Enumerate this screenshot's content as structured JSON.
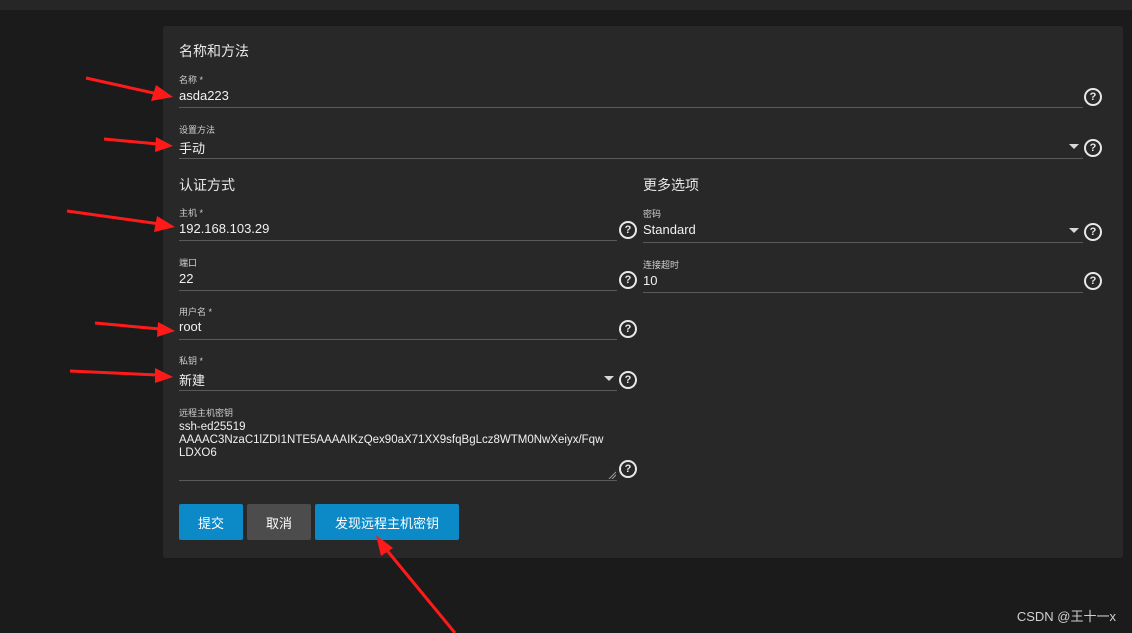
{
  "form": {
    "section_name_method": "名称和方法",
    "name": {
      "label": "名称 *",
      "value": "asda223"
    },
    "setup_method": {
      "label": "设置方法",
      "value": "手动"
    },
    "section_auth": "认证方式",
    "host": {
      "label": "主机 *",
      "value": "192.168.103.29"
    },
    "port": {
      "label": "端口",
      "value": "22"
    },
    "username": {
      "label": "用户名 *",
      "value": "root"
    },
    "private_key": {
      "label": "私钥 *",
      "value": "新建"
    },
    "remote_host_key": {
      "label": "远程主机密钥",
      "lines": [
        "ssh-ed25519",
        "AAAAC3NzaC1lZDI1NTE5AAAAIKzQex90aX71XX9sfqBgLcz8WTM0NwXeiyx/Fqw",
        "LDXO6"
      ]
    },
    "section_more": "更多选项",
    "cipher": {
      "label": "密码",
      "value": "Standard"
    },
    "connect_timeout": {
      "label": "连接超时",
      "value": "10"
    }
  },
  "buttons": {
    "submit": "提交",
    "cancel": "取消",
    "discover": "发现远程主机密钥"
  },
  "help_glyph": "?",
  "watermark": "CSDN @王十一x",
  "colors": {
    "background": "#1b1b1b",
    "card": "#282828",
    "primary_button": "#0c8ac7",
    "secondary_button": "#4c4c4c",
    "annotation_arrow": "#ff1a1a"
  }
}
